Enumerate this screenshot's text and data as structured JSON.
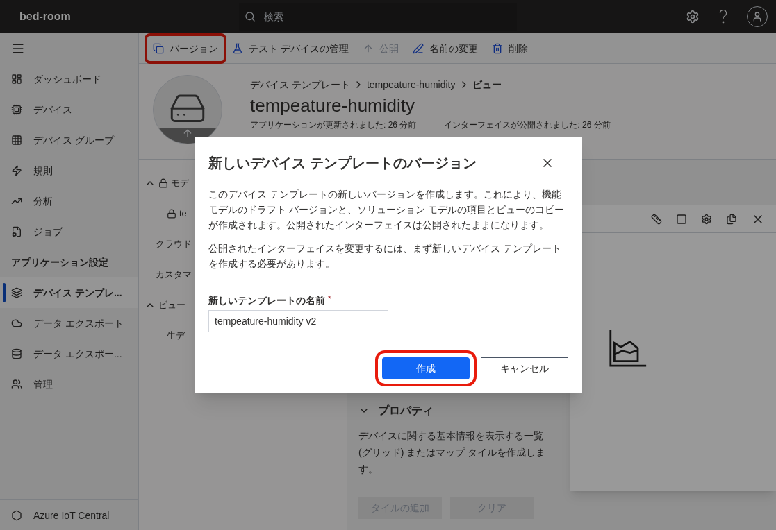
{
  "app_name": "bed-room",
  "search": {
    "placeholder": "検索"
  },
  "toolbar": [
    {
      "label": "バージョン",
      "disabled": false,
      "highlighted": true
    },
    {
      "label": "テスト デバイスの管理",
      "disabled": false,
      "highlighted": false
    },
    {
      "label": "公開",
      "disabled": true,
      "highlighted": false
    },
    {
      "label": "名前の変更",
      "disabled": false,
      "highlighted": false
    },
    {
      "label": "削除",
      "disabled": false,
      "highlighted": false
    }
  ],
  "sidebar": {
    "items": [
      {
        "kind": "item",
        "label": "ダッシュボード",
        "selected": false
      },
      {
        "kind": "item",
        "label": "デバイス",
        "selected": false
      },
      {
        "kind": "item",
        "label": "デバイス グループ",
        "selected": false
      },
      {
        "kind": "item",
        "label": "規則",
        "selected": false
      },
      {
        "kind": "item",
        "label": "分析",
        "selected": false
      },
      {
        "kind": "item",
        "label": "ジョブ",
        "selected": false
      },
      {
        "kind": "heading",
        "label": "アプリケーション設定"
      },
      {
        "kind": "item",
        "label": "デバイス テンプレ...",
        "selected": true
      },
      {
        "kind": "item",
        "label": "データ エクスポート",
        "selected": false
      },
      {
        "kind": "item",
        "label": "データ エクスポー...",
        "selected": false
      },
      {
        "kind": "item",
        "label": "管理",
        "selected": false
      }
    ],
    "footer": "Azure IoT Central"
  },
  "breadcrumb": [
    {
      "label": "デバイス テンプレート",
      "current": false
    },
    {
      "label": "tempeature-humidity",
      "current": false
    },
    {
      "label": "ビュー",
      "current": true
    }
  ],
  "title": "tempeature-humidity",
  "meta": [
    "アプリケーションが更新されました: 26 分前",
    "インターフェイスが公開されました: 26 分前"
  ],
  "tree": [
    {
      "kind": "group",
      "label": "モデ",
      "locked": true
    },
    {
      "kind": "child",
      "label": "te",
      "locked": true
    },
    {
      "kind": "item",
      "label": "クラウド",
      "locked": false
    },
    {
      "kind": "item",
      "label": "カスタマ",
      "locked": false
    },
    {
      "kind": "group",
      "label": "ビュー",
      "locked": false
    },
    {
      "kind": "child",
      "label": "生デ",
      "locked": false
    }
  ],
  "properties": {
    "heading": "プロパティ",
    "description": "デバイスに関する基本情報を表示する一覧 (グリッド) またはマップ タイルを作成します。",
    "buttons": [
      {
        "label": "タイルの追加",
        "disabled": true
      },
      {
        "label": "クリア",
        "disabled": true
      }
    ]
  },
  "dialog": {
    "title": "新しいデバイス テンプレートのバージョン",
    "paragraphs": [
      "このデバイス テンプレートの新しいバージョンを作成します。これにより、機能モデルのドラフト バージョンと、ソリューション モデルの項目とビューのコピーが作成されます。公開されたインターフェイスは公開されたままになります。",
      "公開されたインターフェイスを変更するには、まず新しいデバイス テンプレートを作成する必要があります。"
    ],
    "field": {
      "label": "新しいテンプレートの名前",
      "required": true,
      "required_mark": "*",
      "value": "tempeature-humidity v2"
    },
    "buttons": [
      {
        "label": "作成",
        "kind": "primary",
        "highlighted": true
      },
      {
        "label": "キャンセル",
        "kind": "secondary",
        "highlighted": false
      }
    ]
  }
}
